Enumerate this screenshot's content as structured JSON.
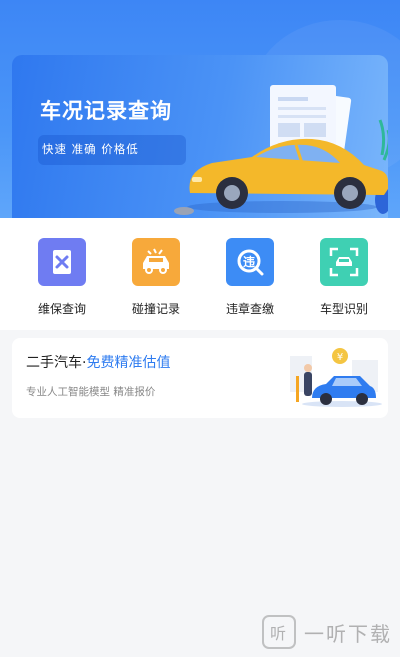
{
  "banner": {
    "title": "车况记录查询",
    "tags": "快速  准确  价格低"
  },
  "features": [
    {
      "label": "维保查询",
      "icon": "maintenance-doc-icon",
      "color": "#6f7cf2"
    },
    {
      "label": "碰撞记录",
      "icon": "crash-car-icon",
      "color": "#f7a93b"
    },
    {
      "label": "违章查缴",
      "icon": "violation-search-icon",
      "color": "#3d8cf5"
    },
    {
      "label": "车型识别",
      "icon": "car-scan-icon",
      "color": "#3fd0b3"
    }
  ],
  "valuation": {
    "title_prefix": "二手汽车·",
    "title_accent": "免费精准估值",
    "subtitle": "专业人工智能模型  精准报价"
  },
  "watermark": {
    "logo_char": "听",
    "text": "一听下载"
  },
  "colors": {
    "primary": "#2f7cf0",
    "banner_blue": "#3d86f5",
    "car_yellow": "#f4b82a"
  }
}
